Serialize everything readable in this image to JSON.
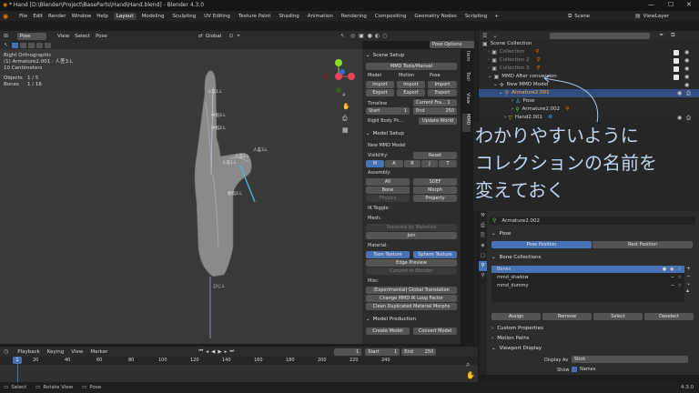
{
  "title": {
    "text": "* Hand [D:\\Blender\\Project\\BaseParts\\Hand\\Hand.blend] - Blender 4.3.0",
    "minimize": "—",
    "maximize": "☐",
    "close": "✕"
  },
  "menu": {
    "items": [
      "File",
      "Edit",
      "Render",
      "Window",
      "Help"
    ],
    "workspaces": [
      "Layout",
      "Modeling",
      "Sculpting",
      "UV Editing",
      "Texture Paint",
      "Shading",
      "Animation",
      "Rendering",
      "Compositing",
      "Geometry Nodes",
      "Scripting"
    ],
    "active_workspace": "Layout",
    "scene": "Scene",
    "view_layer": "ViewLayer"
  },
  "viewport": {
    "mode": "Pose Mode",
    "menus": [
      "View",
      "Select",
      "Pose"
    ],
    "transform": "Global",
    "pose_options": "Pose Options",
    "view_name": "Right Orthographic",
    "active": "(1) Armature2.001 : 人差3.L",
    "scale": "10 Centimeters",
    "objects_label": "Objects",
    "objects_value": "1 / 5",
    "bones_label": "Bones",
    "bones_value": "1 / 16",
    "bone_labels": [
      "人差1.L",
      "中指3.L",
      "中指2.L",
      "人差3.L",
      "人差2.L",
      "人差1.L",
      "親指2.L",
      "ひじ.L"
    ]
  },
  "mmd_panel": {
    "scene_setup": "Scene Setup",
    "tools_manual": "MMD Tools/Manual",
    "model": "Model",
    "motion": "Motion",
    "pose": "Pose",
    "import": "Import",
    "export": "Export",
    "timeline": "Timeline",
    "current_frame": "Current Fra... 1",
    "start_label": "Start",
    "start_value": "1",
    "end_label": "End",
    "end_value": "250",
    "rigid_body": "Rigid Body Ph...",
    "update_world": "Update World",
    "model_setup": "Model Setup",
    "new_mmd_model": "New MMD Model",
    "visibility": "Visibility:",
    "reset": "Reset",
    "assembly": "Assembly:",
    "all": "All",
    "sdef": "SDEF",
    "bone": "Bone",
    "morph": "Morph",
    "physics": "Physics",
    "property": "Property",
    "ik_toggle": "IK Toggle:",
    "mesh": "Mesh:",
    "separate_by_materials": "Separate by Materials",
    "join": "Join",
    "material": "Material:",
    "toon_texture": "Toon Texture",
    "sphere_texture": "Sphere Texture",
    "edge_preview": "Edge Preview",
    "convert_to_blender": "Convert to Blender",
    "misc": "Misc:",
    "experimental_translation": "(Experimental) Global Translation",
    "change_ik_loop": "Change MMD IK Loop Factor",
    "clean_morphs": "Clean Duplicated Material Morphs",
    "model_production": "Model Production",
    "create_model": "Create Model",
    "convert_model": "Convert Model",
    "side_tabs": [
      "Item",
      "Tool",
      "View",
      "MMD"
    ]
  },
  "outliner": {
    "scene_collection": "Scene Collection",
    "rows": [
      {
        "label": "Collection",
        "indent": 1
      },
      {
        "label": "Collection 2",
        "indent": 1
      },
      {
        "label": "Collection 3",
        "indent": 1
      },
      {
        "label": "MMD After conversion",
        "indent": 1
      },
      {
        "label": "New MMD Model",
        "indent": 2
      },
      {
        "label": "Armature2.001",
        "indent": 3,
        "selected": true
      },
      {
        "label": "Pose",
        "indent": 4
      },
      {
        "label": "Armature2.002",
        "indent": 4
      },
      {
        "label": "Hand2.001",
        "indent": 3
      }
    ]
  },
  "annotation": {
    "lines": [
      "わかりやすいように",
      "コレクションの名前を",
      "変えておく"
    ]
  },
  "properties": {
    "armature_name": "Armature2.002",
    "pose_section": "Pose",
    "pose_position": "Pose Position",
    "rest_position": "Rest Position",
    "bone_collections": "Bone Collections",
    "collections": [
      "Bones",
      "mmd_shadow",
      "mmd_dummy"
    ],
    "assign": "Assign",
    "remove": "Remove",
    "select": "Select",
    "deselect": "Deselect",
    "custom_properties": "Custom Properties",
    "motion_paths": "Motion Paths",
    "viewport_display": "Viewport Display",
    "display_as_label": "Display As",
    "display_as_value": "Stick",
    "show_label": "Show",
    "names": "Names"
  },
  "timeline": {
    "playback": "Playback",
    "keying": "Keying",
    "view": "View",
    "marker": "Marker",
    "current_frame": "1",
    "start_label": "Start",
    "start_value": "1",
    "end_label": "End",
    "end_value": "250",
    "ticks": [
      "1",
      "20",
      "40",
      "60",
      "80",
      "100",
      "120",
      "140",
      "160",
      "180",
      "200",
      "220",
      "240"
    ]
  },
  "status_bar": {
    "select": "Select",
    "rotate_view": "Rotate View",
    "pose": "Pose",
    "version": "4.3.0"
  }
}
